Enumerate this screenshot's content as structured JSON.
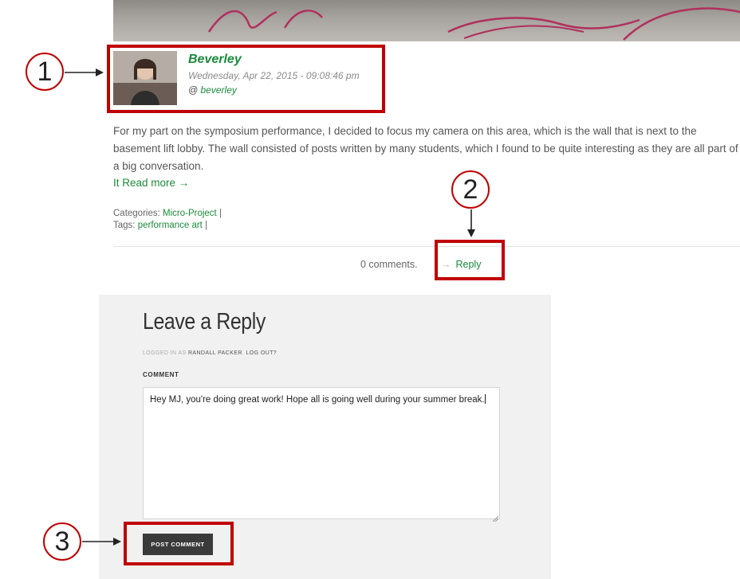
{
  "post": {
    "author": "Beverley",
    "date": "Wednesday, Apr 22, 2015 - 09:08:46 pm",
    "handle_prefix": "@ ",
    "handle": "beverley",
    "body": "For my part on the symposium performance, I decided to focus my camera on this area, which is the wall that is next to the basement lift lobby. The wall consisted of posts written by many students, which I found to be quite interesting as they are all part of a big conversation.",
    "read_more_prefix": "It ",
    "read_more": "Read more →",
    "categories_label": "Categories:",
    "category": "Micro-Project",
    "tags_label": "Tags:",
    "tag": "performance art",
    "separator": "|",
    "comments_count": "0 comments.",
    "reply_arrow": "→",
    "reply": "Reply"
  },
  "reply_form": {
    "title": "Leave a Reply",
    "logged_in_prefix": "LOGGED IN AS ",
    "user_name": "RANDALL PACKER",
    "logout": "LOG OUT?",
    "comment_label": "COMMENT",
    "comment_value": "Hey MJ, you're doing great work! Hope all is going well during your summer break.",
    "submit": "POST COMMENT"
  },
  "annotations": {
    "callouts": [
      "1",
      "2",
      "3"
    ],
    "color": "#c00000"
  },
  "colors": {
    "link_green": "#1b8a3b",
    "panel_bg": "#f1f1f1",
    "button_bg": "#3a3a3a"
  }
}
